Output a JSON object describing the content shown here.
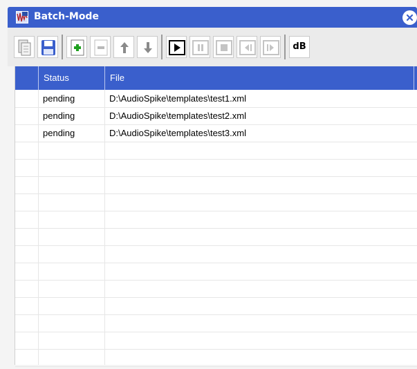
{
  "window": {
    "title": "Batch-Mode",
    "accent_color": "#3a5fcc"
  },
  "toolbar": {
    "buttons": [
      {
        "name": "copy-button",
        "icon": "copy-icon"
      },
      {
        "name": "save-button",
        "icon": "save-icon"
      },
      {
        "name": "add-button",
        "icon": "add-icon"
      },
      {
        "name": "remove-button",
        "icon": "remove-icon"
      },
      {
        "name": "move-up-button",
        "icon": "arrow-up-icon"
      },
      {
        "name": "move-down-button",
        "icon": "arrow-down-icon"
      },
      {
        "name": "play-button",
        "icon": "play-icon"
      },
      {
        "name": "pause-button",
        "icon": "pause-icon"
      },
      {
        "name": "stop-button",
        "icon": "stop-icon"
      },
      {
        "name": "previous-button",
        "icon": "previous-icon"
      },
      {
        "name": "next-button",
        "icon": "next-icon"
      }
    ],
    "db_label": "dB"
  },
  "table": {
    "columns": [
      "Status",
      "File"
    ],
    "rows": [
      {
        "status": "pending",
        "file": "D:\\AudioSpike\\templates\\test1.xml"
      },
      {
        "status": "pending",
        "file": "D:\\AudioSpike\\templates\\test2.xml"
      },
      {
        "status": "pending",
        "file": "D:\\AudioSpike\\templates\\test3.xml"
      }
    ]
  }
}
